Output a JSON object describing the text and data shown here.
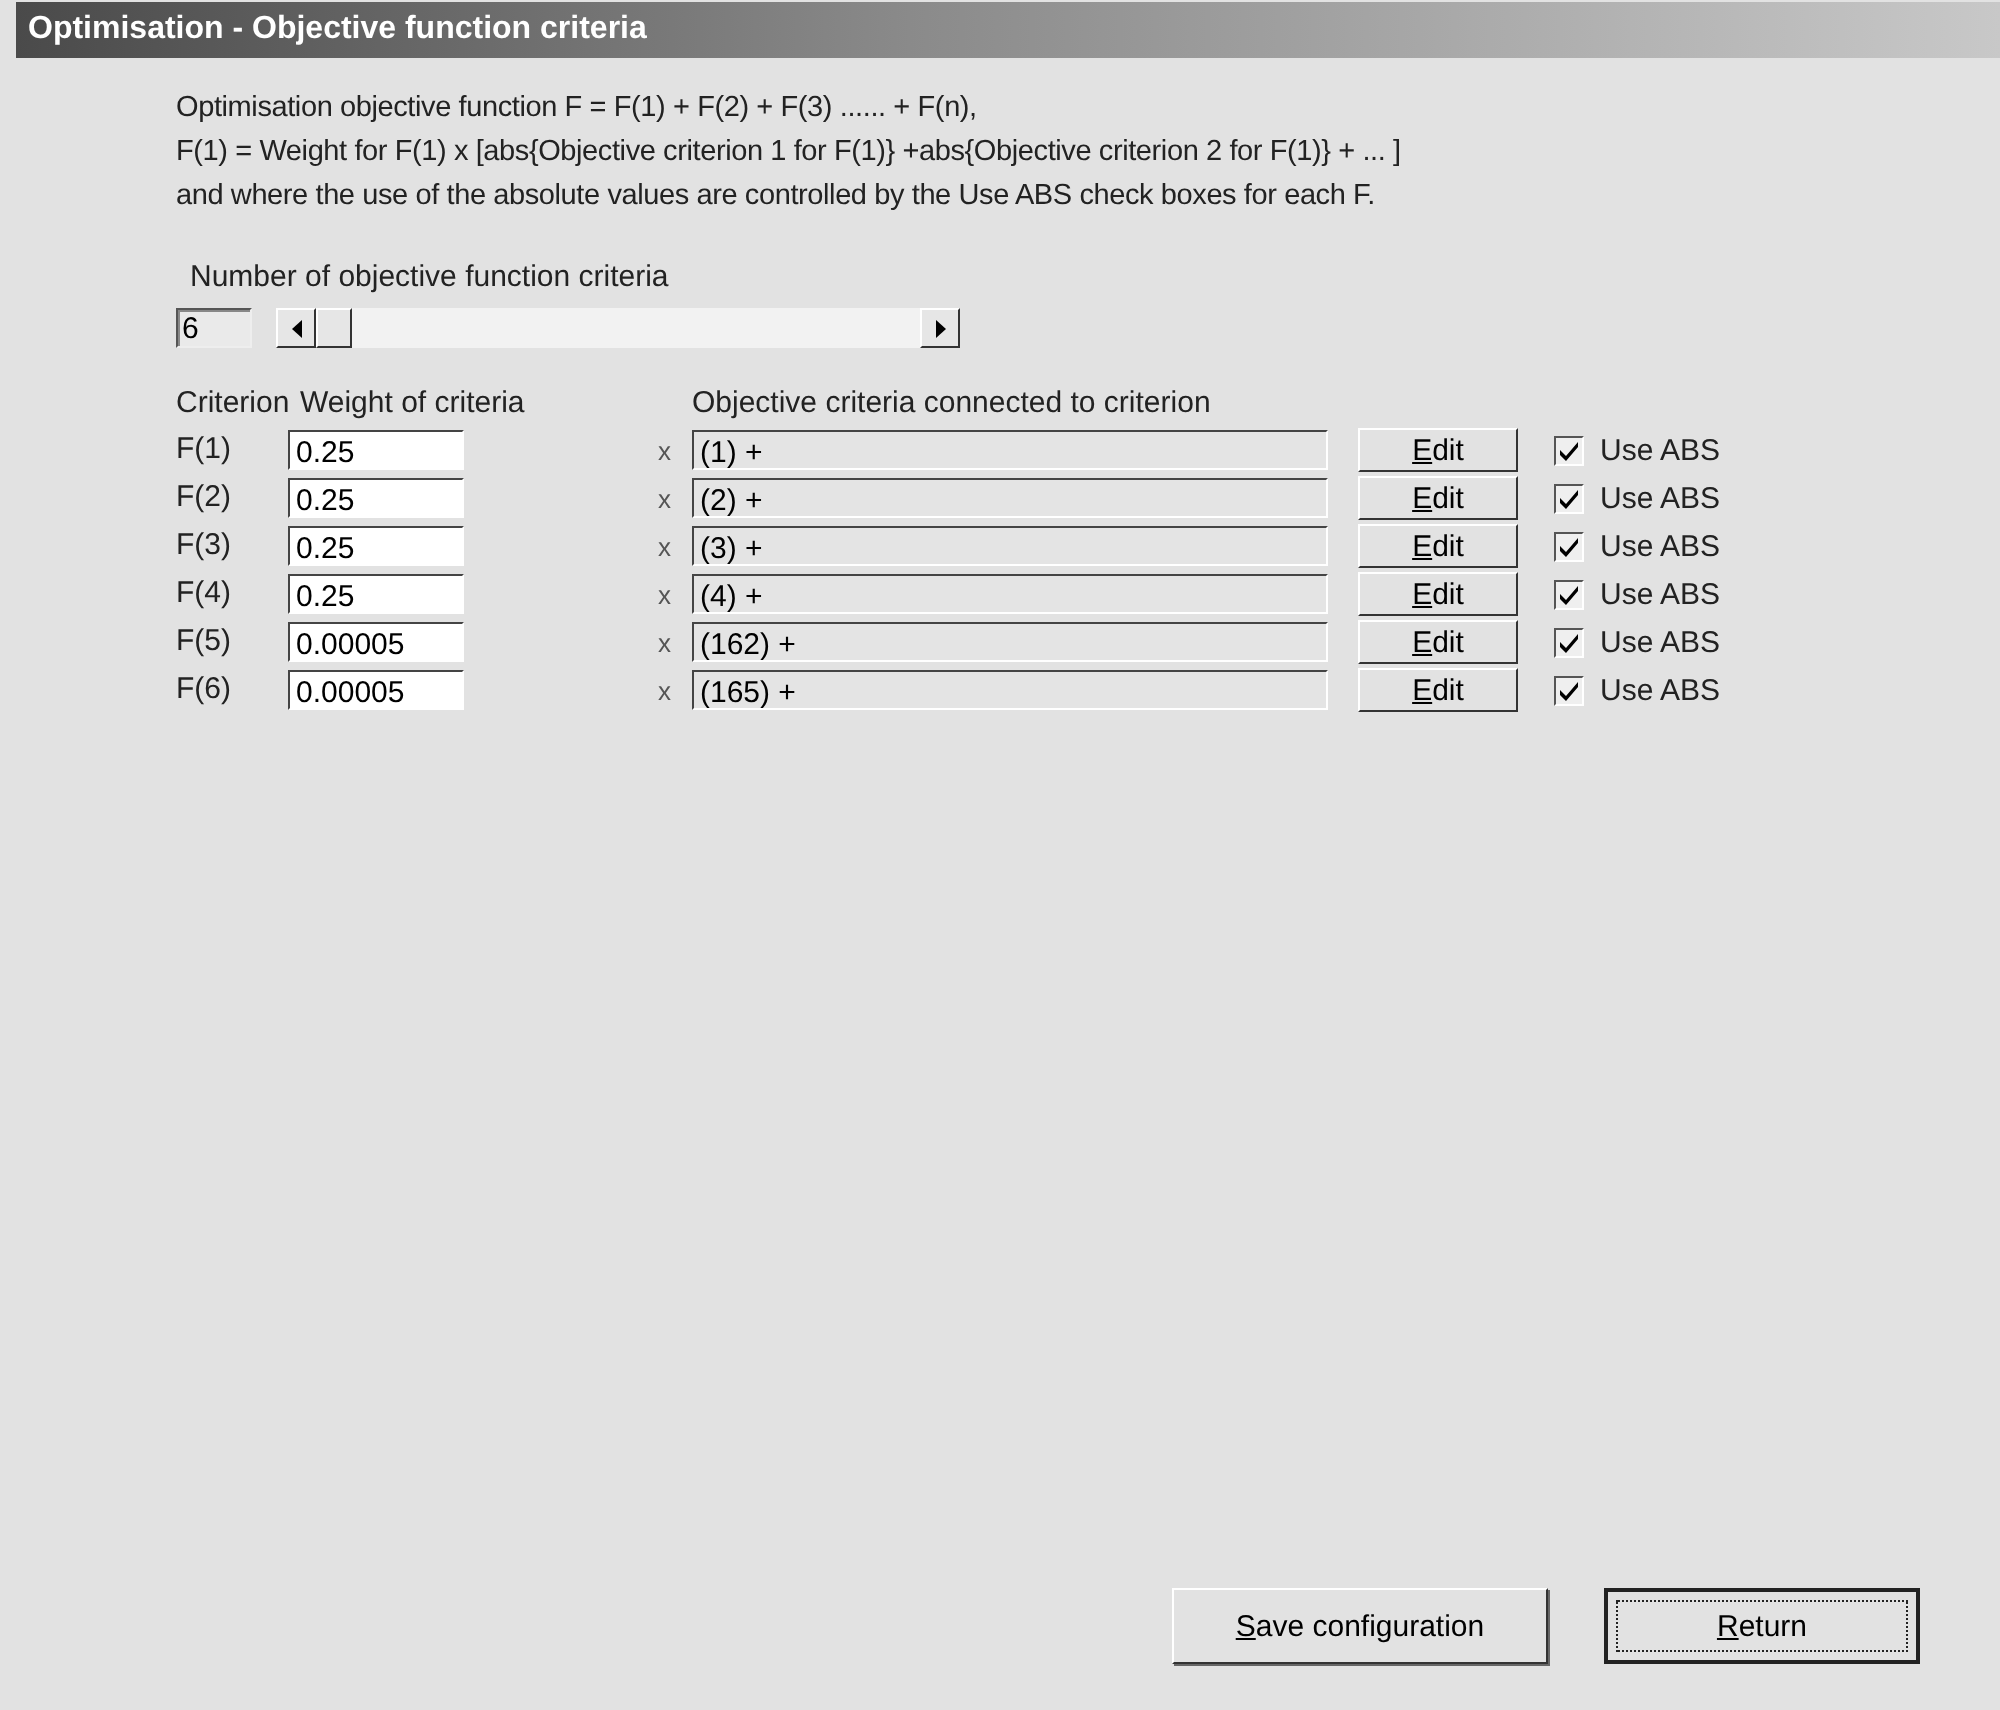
{
  "window": {
    "title": "Optimisation - Objective function criteria"
  },
  "description": [
    "Optimisation objective function F = F(1) + F(2) + F(3) ...... + F(n),",
    "F(1) = Weight for F(1) x [abs{Objective criterion 1 for F(1)} +abs{Objective criterion 2 for F(1)} + ... ]",
    "and where the use of the absolute values are controlled by the Use ABS check boxes for each F."
  ],
  "count": {
    "label": "Number of objective function criteria",
    "value": "6",
    "level": 0
  },
  "columns": [
    "Criterion",
    "Weight of criteria",
    "Objective criteria connected to criterion"
  ],
  "rows": [
    {
      "criterion": "F(1)",
      "weight": "0.25",
      "times": "x",
      "objectives": "(1) +",
      "edit": "Edit",
      "use_abs": "Use ABS",
      "checked": true
    },
    {
      "criterion": "F(2)",
      "weight": "0.25",
      "times": "x",
      "objectives": "(2) +",
      "edit": "Edit",
      "use_abs": "Use ABS",
      "checked": true
    },
    {
      "criterion": "F(3)",
      "weight": "0.25",
      "times": "x",
      "objectives": "(3) +",
      "edit": "Edit",
      "use_abs": "Use ABS",
      "checked": true
    },
    {
      "criterion": "F(4)",
      "weight": "0.25",
      "times": "x",
      "objectives": "(4) +",
      "edit": "Edit",
      "use_abs": "Use ABS",
      "checked": true
    },
    {
      "criterion": "F(5)",
      "weight": "0.00005",
      "times": "x",
      "objectives": "(162) +",
      "edit": "Edit",
      "use_abs": "Use ABS",
      "checked": true
    },
    {
      "criterion": "F(6)",
      "weight": "0.00005",
      "times": "x",
      "objectives": "(165) +",
      "edit": "Edit",
      "use_abs": "Use ABS",
      "checked": true
    }
  ],
  "buttons": [
    {
      "label": "Save configuration",
      "default": false
    },
    {
      "label": "Return",
      "default": true
    }
  ]
}
